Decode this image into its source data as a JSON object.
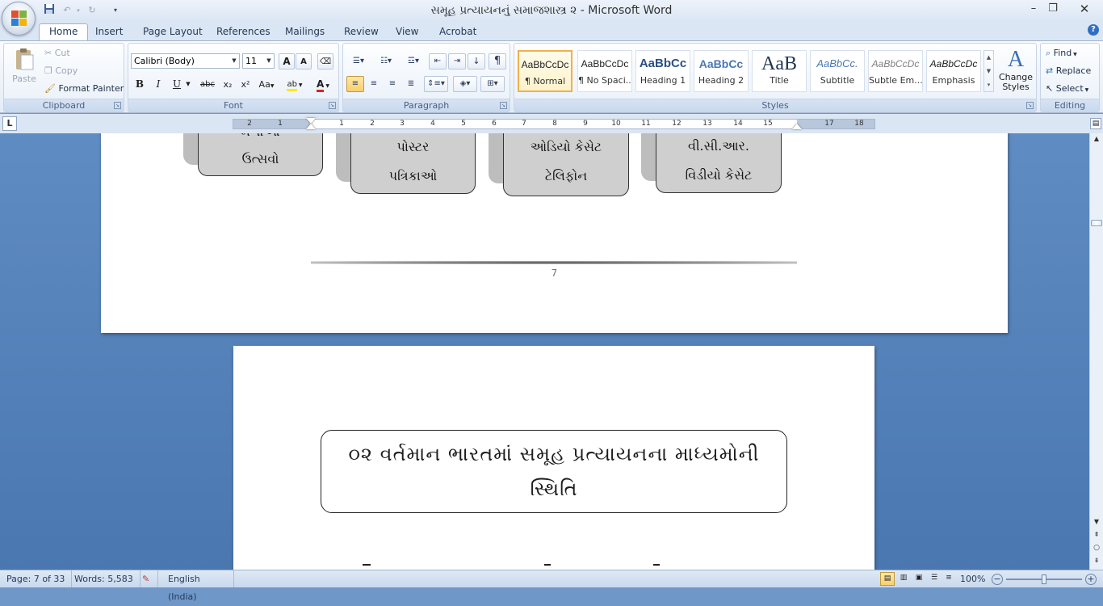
{
  "app": {
    "title": "સમૂહ પ્રત્યાયનનું સમાજશાસ્ત્ર ૨ - Microsoft Word",
    "window_buttons": [
      "–",
      "❐",
      "✕"
    ],
    "help": "?"
  },
  "tabs": [
    "Home",
    "Insert",
    "Page Layout",
    "References",
    "Mailings",
    "Review",
    "View",
    "Acrobat"
  ],
  "ribbon": {
    "clipboard": {
      "label": "Clipboard",
      "paste": "Paste",
      "cut": "Cut",
      "copy": "Copy",
      "format_painter": "Format Painter"
    },
    "font": {
      "label": "Font",
      "font_name": "Calibri (Body)",
      "font_size": "11",
      "grow": "A",
      "shrink": "A",
      "bold": "B",
      "italic": "I",
      "underline": "U",
      "strike": "abc",
      "subscript": "x₂",
      "superscript": "x²",
      "change_case": "Aa",
      "highlight": "ab",
      "font_color": "A"
    },
    "paragraph": {
      "label": "Paragraph",
      "sort": "↓",
      "pilcrow": "¶"
    },
    "styles": {
      "label": "Styles",
      "items": [
        {
          "preview": "AaBbCcDc",
          "name": "¶ Normal"
        },
        {
          "preview": "AaBbCcDc",
          "name": "¶ No Spaci..."
        },
        {
          "preview": "AaBbCc",
          "name": "Heading 1"
        },
        {
          "preview": "AaBbCc",
          "name": "Heading 2"
        },
        {
          "preview": "AaB",
          "name": "Title"
        },
        {
          "preview": "AaBbCc.",
          "name": "Subtitle"
        },
        {
          "preview": "AaBbCcDc",
          "name": "Subtle Em..."
        },
        {
          "preview": "AaBbCcDc",
          "name": "Emphasis"
        }
      ],
      "change_styles": "Change Styles",
      "change_styles_line1": "Change",
      "change_styles_line2": "Styles"
    },
    "editing": {
      "label": "Editing",
      "find": "Find",
      "replace": "Replace",
      "select": "Select"
    }
  },
  "ruler": {
    "tab_selector": "L",
    "left_numbers": [
      "2",
      "1"
    ],
    "right_numbers": [
      "1",
      "2",
      "3",
      "4",
      "5",
      "6",
      "7",
      "8",
      "9",
      "10",
      "11",
      "12",
      "13",
      "14",
      "15",
      "17",
      "18"
    ]
  },
  "document": {
    "page1_boxes": [
      {
        "line1": "મેળાઓ",
        "line2": "ઉત્સવો"
      },
      {
        "line1": "પોસ્ટર",
        "line2": "પત્રિકાઓ"
      },
      {
        "line1": "ઓડિયો કેસેટ",
        "line2": "ટેલિફોન"
      },
      {
        "line1": "વી.સી.આર.",
        "line2": "વિડીયો કેસેટ"
      }
    ],
    "page_number": "7",
    "heading_line1": "૦૨ વર્તમાન ભારતમાં સમૂહ પ્રત્યાયનના માધ્યમોની",
    "heading_line2": "સ્થિતિ"
  },
  "status": {
    "page": "Page: 7 of 33",
    "words": "Words: 5,583",
    "language": "English (India)",
    "zoom": "100%"
  }
}
